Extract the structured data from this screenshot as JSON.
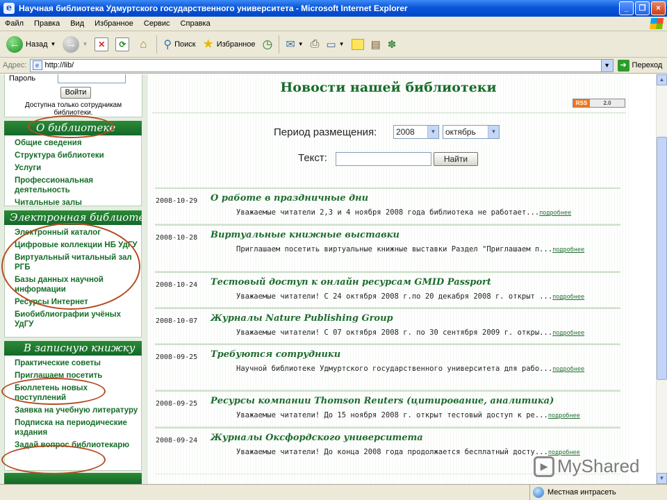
{
  "window": {
    "title": "Научная библиотека Удмуртского государственного университета - Microsoft Internet Explorer",
    "buttons": [
      "_",
      "❐",
      "×"
    ]
  },
  "menu": [
    "Файл",
    "Правка",
    "Вид",
    "Избранное",
    "Сервис",
    "Справка"
  ],
  "toolbar": {
    "back": "Назад",
    "search": "Поиск",
    "favorites": "Избранное"
  },
  "address": {
    "label": "Адрес:",
    "url": "http://lib/",
    "go": "Переход"
  },
  "sidebar": {
    "login": {
      "password_label": "Пароль",
      "button": "Войти",
      "note": "Доступна только сотрудникам библиотеки."
    },
    "sections": [
      {
        "title": "О библиотеке",
        "items": [
          "Общие сведения",
          "Структура библиотеки",
          "Услуги",
          "Профессиональная деятельность",
          "Читальные залы"
        ]
      },
      {
        "title": "Электронная библиотека",
        "items": [
          "Электронный каталог",
          "Цифровые коллекции НБ УдГУ",
          "Виртуальный читальный зал РГБ",
          "Базы данных научной информации",
          "Ресурсы Интернет",
          "Биобиблиографии учёных УдГУ"
        ]
      },
      {
        "title": "В записную книжку",
        "items": [
          "Практические советы",
          "Приглашаем посетить",
          "Бюллетень новых поступлений",
          "Заявка на учебную литературу",
          "Подписка на периодические издания",
          "Задай вопрос библиотекарю"
        ]
      }
    ]
  },
  "main": {
    "title": "Новости нашей библиотеки",
    "rss": {
      "label": "RSS",
      "version": "2.0"
    },
    "filter": {
      "period_label": "Период размещения:",
      "year": "2008",
      "month": "октябрь",
      "text_label": "Текст:",
      "button": "Найти"
    },
    "more_label": "подробнее",
    "news": [
      {
        "date": "2008-10-29",
        "title": "О работе в праздничные дни",
        "text": "Уважаемые читатели 2,3 и 4 ноября 2008 года библиотека не работает..."
      },
      {
        "date": "2008-10-28",
        "title": "Виртуальные книжные выставки",
        "text": "Приглашаем посетить виртуальные книжные выставки Раздел \"Приглашаем п..."
      },
      {
        "date": "2008-10-24",
        "title": "Тестовый доступ к онлайн ресурсам GMID Passport",
        "text": "Уважаемые читатели! С 24 октября 2008 г.по 20 декабря 2008 г. открыт ..."
      },
      {
        "date": "2008-10-07",
        "title": "Журналы Nature Publishing Group",
        "text": "Уважаемые читатели! С 07 октября 2008 г. по 30 сентября 2009 г. откры..."
      },
      {
        "date": "2008-09-25",
        "title": "Требуются сотрудники",
        "text": "Научной библиотеке Удмуртского государственного университета для рабо..."
      },
      {
        "date": "2008-09-25",
        "title": "Ресурсы компании Thomson Reuters (цитирование, аналитика)",
        "text": "Уважаемые читатели! До 15 ноября 2008 г. открыт тестовый доступ к ре..."
      },
      {
        "date": "2008-09-24",
        "title": "Журналы Оксфордского университета",
        "text": "Уважаемые читатели! До конца 2008 года продолжается бесплатный досту..."
      }
    ]
  },
  "status": {
    "zone": "Местная интрасеть"
  },
  "watermark": "MyShared"
}
